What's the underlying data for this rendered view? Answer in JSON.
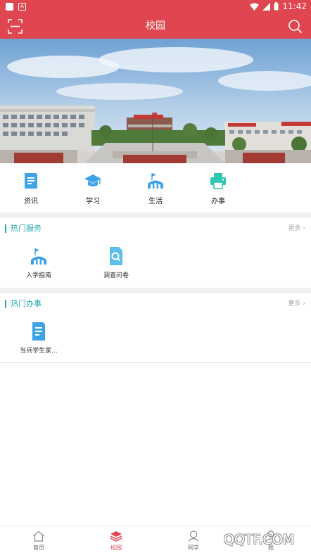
{
  "status": {
    "time": "11:42",
    "notif_letter": "A"
  },
  "header": {
    "title": "校园"
  },
  "quick_links": [
    {
      "label": "资讯",
      "icon": "news-doc-icon"
    },
    {
      "label": "学习",
      "icon": "graduation-cap-icon"
    },
    {
      "label": "生活",
      "icon": "stadium-flag-icon"
    },
    {
      "label": "办事",
      "icon": "printer-icon"
    }
  ],
  "hot_services": {
    "title": "热门服务",
    "more": "更多",
    "items": [
      {
        "label": "入学指南",
        "icon": "stadium-flag-icon"
      },
      {
        "label": "调查问卷",
        "icon": "search-doc-icon"
      }
    ]
  },
  "hot_affairs": {
    "title": "热门办事",
    "more": "更多",
    "items": [
      {
        "label": "当兵学生家...",
        "icon": "document-icon"
      }
    ]
  },
  "tabs": [
    {
      "label": "首页",
      "icon": "home-icon",
      "active": false
    },
    {
      "label": "校园",
      "icon": "layers-icon",
      "active": true
    },
    {
      "label": "同学",
      "icon": "classmates-icon",
      "active": false
    },
    {
      "label": "我",
      "icon": "profile-icon",
      "active": false
    }
  ],
  "watermark": "QQTF.COM",
  "colors": {
    "accent": "#e0464f",
    "section": "#27a9b3",
    "icon_blue": "#3fa3e8",
    "icon_teal": "#2ec7b0"
  }
}
